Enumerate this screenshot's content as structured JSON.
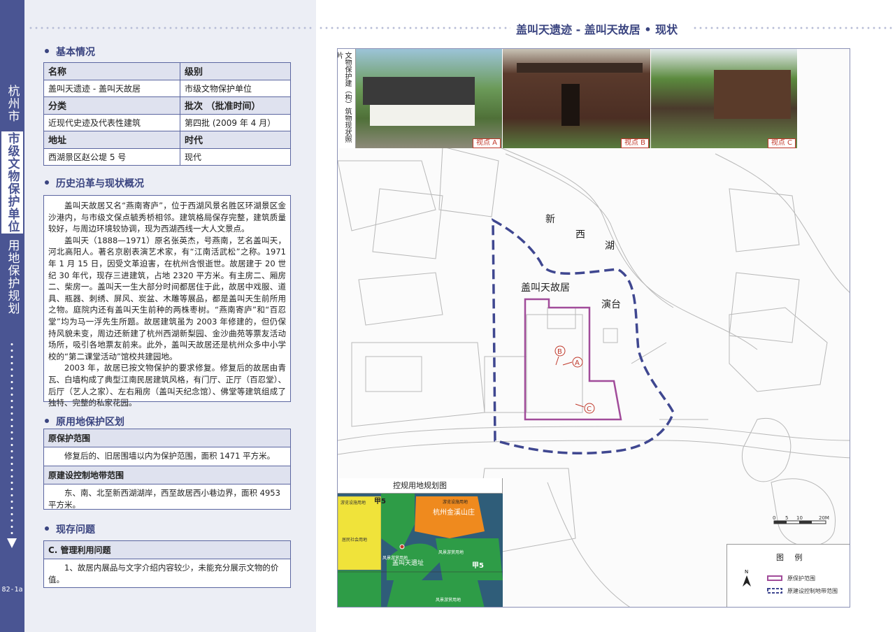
{
  "sidebar": {
    "city": "杭州市",
    "unit": "市级文物保护单位",
    "plan": "用地保护规划",
    "page_number": "82-1a"
  },
  "page_title": "盖叫天遗迹 - 盖叫天故居 • 现状",
  "basic_info": {
    "heading": "基本情况",
    "rows": [
      {
        "c1": "名称",
        "c2": "级别",
        "header": true
      },
      {
        "c1": "盖叫天遗迹 - 盖叫天故居",
        "c2": "市级文物保护单位",
        "header": false
      },
      {
        "c1": "分类",
        "c2": "批次 （批准时间）",
        "header": true
      },
      {
        "c1": "近现代史迹及代表性建筑",
        "c2": "第四批 (2009 年 4 月）",
        "header": false
      },
      {
        "c1": "地址",
        "c2": "时代",
        "header": true
      },
      {
        "c1": "西湖景区赵公堤 5 号",
        "c2": "现代",
        "header": false
      }
    ]
  },
  "history": {
    "heading": "历史沿革与现状概况",
    "paragraphs": [
      "盖叫天故居又名“燕南寄庐”，位于西湖风景名胜区环湖景区金沙港内，与市级文保点毓秀桥相邻。建筑格局保存完整，建筑质量较好，与周边环境较协调，现为西湖西线一大人文景点。",
      "盖叫天（1888—1971）原名张英杰，号燕南，艺名盖叫天，河北高阳人。著名京剧表演艺术家，有“江南活武松”之称。1971 年 1 月 15 日，因受文革迫害，在杭州含恨逝世。故居建于 20 世纪 30 年代，现存三进建筑，占地 2320 平方米。有主房二、厢房二、柴房一。盖叫天一生大部分时间都居住于此，故居中戏服、道具、瓶器、刺绣、屏风、炭盆、木雕等展品，都是盖叫天生前所用之物。庭院内还有盖叫天生前种的两株枣树。“燕南寄庐”和“百忍堂”均为马一浮先生所题。故居建筑虽为 2003 年修建的，但仍保持风貌未变，周边还新建了杭州西湖新梨园、金沙曲苑等票友活动场所，吸引各地票友前来。此外，盖叫天故居还是杭州众多中小学校的“第二课堂活动”馆校共建园地。",
      "2003 年，故居已按文物保护的要求修复。修复后的故居由青瓦、白墙构成了典型江南民居建筑风格，有门厅、正厅（百忍堂）、后厅（艺人之家）、左右厢房（盖叫天纪念馆）、佛堂等建筑组成了独特、完整的私家花园。"
    ]
  },
  "land": {
    "heading": "原用地保护区划",
    "orig_title": "原保护范围",
    "orig_text": "修复后的、旧居围墙以内为保护范围，面积 1471 平方米。",
    "ctrl_title": "原建设控制地带范围",
    "ctrl_text": "东、南、北至新西湖湖岸，西至故居西小巷边界，面积 4953 平方米。"
  },
  "problems": {
    "heading": "现存问题",
    "sub_title": "C. 管理利用问题",
    "text": "1、故居内展品与文字介绍内容较少，未能充分展示文物的价值。"
  },
  "map": {
    "photo_label": "文物保护建（构）筑物现状照片",
    "photos": [
      "视点 A",
      "视点 B",
      "视点 C"
    ],
    "labels": {
      "lake_1": "新",
      "lake_2": "西",
      "lake_3": "湖",
      "residence": "盖叫天故居",
      "stage": "演台",
      "view_a": "A",
      "view_b": "B",
      "view_c": "C"
    },
    "inset": {
      "title": "控规用地规划图",
      "jia5_top": "甲5",
      "jia5_bottom": "甲5",
      "villa": "杭州金溪山庄",
      "site": "盖叫天遗址",
      "green_1": "风景游赏用地",
      "green_2": "风景游赏用地",
      "green_3": "风景游赏用地",
      "resort": "游览设施用地",
      "yellow_top": "游览设施用地",
      "yellow_mid": "居民社会用地"
    },
    "scale": {
      "t0": "0",
      "t1": "5",
      "t2": "10",
      "t3": "20M"
    },
    "legend": {
      "title": "图 例",
      "north": "N",
      "orig": "原保护范围",
      "ctrl": "原建设控制地带范围"
    },
    "colors": {
      "protection": "#a14c9a",
      "control": "#3f4790",
      "water": "#2f5d79",
      "green": "#2e9c47",
      "orange": "#ef8a1e",
      "yellow": "#f0e33a"
    }
  }
}
